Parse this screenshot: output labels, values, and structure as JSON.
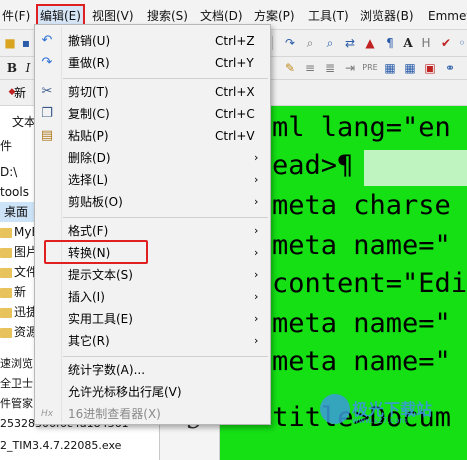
{
  "menubar": {
    "items": [
      "件(F)",
      "编辑(E)",
      "视图(V)",
      "搜索(S)",
      "文档(D)",
      "方案(P)",
      "工具(T)",
      "浏览器(B)",
      "Emmet"
    ],
    "active_index": 1
  },
  "toolbar": {
    "row2_items": [
      "B",
      "I"
    ],
    "row3_items": [
      "新",
      "文"
    ]
  },
  "left_panel": {
    "items": [
      "文本",
      "件",
      "D:\\",
      "tools",
      "桌面",
      "MyE",
      "图片",
      "文件",
      "新",
      "迅捷",
      "资源"
    ],
    "selected": "桌面"
  },
  "lower_list": {
    "items": [
      "速浏览",
      "全卫士",
      "件管家",
      "25328306f6c4a184361",
      "2_TIM3.4.7.22085.exe"
    ]
  },
  "editor": {
    "line_number": "9",
    "lines": [
      "ml lang=\"en",
      "ead>¶",
      "meta charse",
      "meta name=\"",
      "content=\"Edi",
      "meta name=\"",
      "meta name=\"",
      "<title>Docum"
    ]
  },
  "edit_menu": {
    "items": [
      {
        "icon": "undo-icon",
        "label": "撤销(U)",
        "shortcut": "Ctrl+Z"
      },
      {
        "icon": "redo-icon",
        "label": "重做(R)",
        "shortcut": "Ctrl+Y"
      },
      {
        "icon": "cut-icon",
        "label": "剪切(T)",
        "shortcut": "Ctrl+X"
      },
      {
        "icon": "copy-icon",
        "label": "复制(C)",
        "shortcut": "Ctrl+C"
      },
      {
        "icon": "paste-icon",
        "label": "粘贴(P)",
        "shortcut": "Ctrl+V"
      },
      {
        "label": "删除(D)",
        "submenu": true
      },
      {
        "label": "选择(L)",
        "submenu": true
      },
      {
        "label": "剪贴板(O)",
        "submenu": true
      },
      {
        "label": "格式(F)",
        "submenu": true
      },
      {
        "label": "转换(N)",
        "submenu": true,
        "highlighted": true
      },
      {
        "label": "提示文本(S)",
        "submenu": true
      },
      {
        "label": "插入(I)",
        "submenu": true
      },
      {
        "label": "实用工具(E)",
        "submenu": true
      },
      {
        "label": "其它(R)",
        "submenu": true
      },
      {
        "label": "统计字数(A)..."
      },
      {
        "label": "允许光标移出行尾(V)"
      },
      {
        "icon": "hex-icon",
        "label": "16进制查看器(X)",
        "disabled": true
      }
    ],
    "arrow_glyph": "›",
    "hex_icon_text": "Hx"
  },
  "watermark": {
    "text": "极光下载站",
    "sub": "www.xz7.com"
  },
  "colors": {
    "editor_bg": "#14e014",
    "highlight_red": "#e02020",
    "menu_bg": "#f2f2f2"
  }
}
